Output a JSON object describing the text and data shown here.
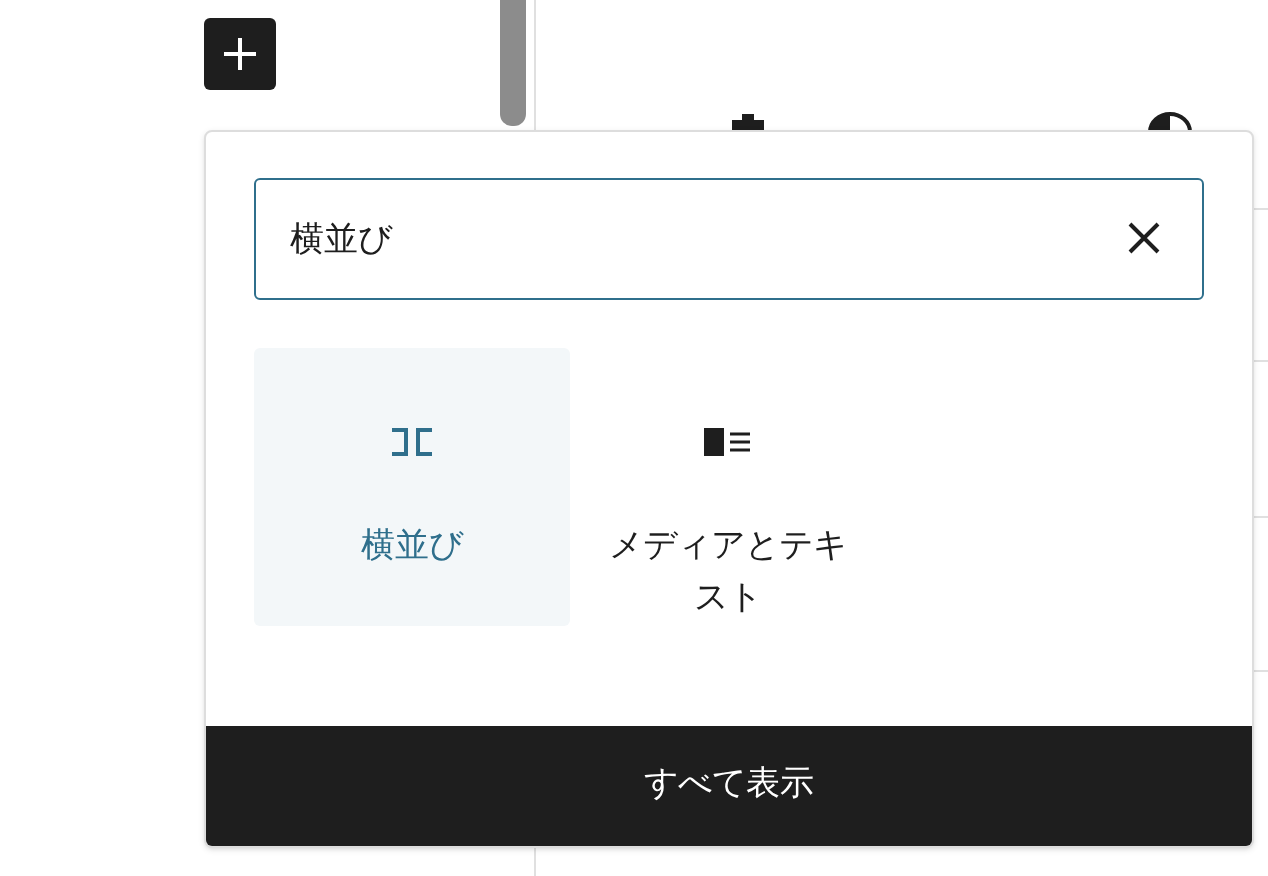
{
  "search": {
    "value": "横並び"
  },
  "blocks": [
    {
      "label": "横並び",
      "kind": "row",
      "selected": true
    },
    {
      "label": "メディアとテキスト",
      "kind": "media-text",
      "selected": false
    }
  ],
  "footer_button": "すべて表示"
}
